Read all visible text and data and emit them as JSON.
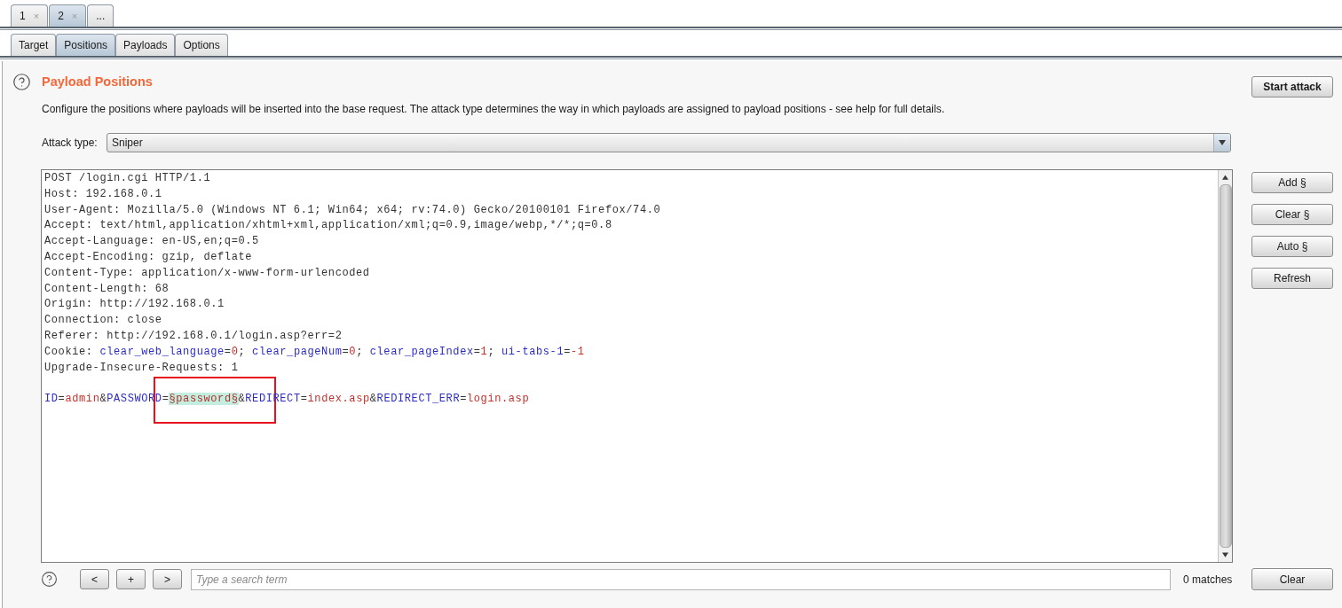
{
  "instance_tabs": [
    {
      "label": "1",
      "close": "×",
      "selected": false
    },
    {
      "label": "2",
      "close": "×",
      "selected": true
    },
    {
      "label": "...",
      "selected": false
    }
  ],
  "tabs": [
    {
      "label": "Target",
      "selected": false
    },
    {
      "label": "Positions",
      "selected": true
    },
    {
      "label": "Payloads",
      "selected": false
    },
    {
      "label": "Options",
      "selected": false
    }
  ],
  "section": {
    "title": "Payload Positions",
    "description": "Configure the positions where payloads will be inserted into the base request. The attack type determines the way in which payloads are assigned to payload positions - see help for full details.",
    "start_button": "Start attack"
  },
  "attack_type": {
    "label": "Attack type:",
    "value": "Sniper"
  },
  "editor": {
    "header_lines": [
      [
        {
          "text": "POST /login.cgi HTTP/1.1",
          "kind": "plain"
        }
      ],
      [
        {
          "text": "Host: 192.168.0.1",
          "kind": "plain"
        }
      ],
      [
        {
          "text": "User-Agent: Mozilla/5.0 (Windows NT 6.1; Win64; x64; rv:74.0) Gecko/20100101 Firefox/74.0",
          "kind": "plain"
        }
      ],
      [
        {
          "text": "Accept: text/html,application/xhtml+xml,application/xml;q=0.9,image/webp,*/*;q=0.8",
          "kind": "plain"
        }
      ],
      [
        {
          "text": "Accept-Language: en-US,en;q=0.5",
          "kind": "plain"
        }
      ],
      [
        {
          "text": "Accept-Encoding: gzip, deflate",
          "kind": "plain"
        }
      ],
      [
        {
          "text": "Content-Type: application/x-www-form-urlencoded",
          "kind": "plain"
        }
      ],
      [
        {
          "text": "Content-Length: 68",
          "kind": "plain"
        }
      ],
      [
        {
          "text": "Origin: http://192.168.0.1",
          "kind": "plain"
        }
      ],
      [
        {
          "text": "Connection: close",
          "kind": "plain"
        }
      ],
      [
        {
          "text": "Referer: http://192.168.0.1/login.asp?err=2",
          "kind": "plain"
        }
      ],
      [
        {
          "text": "Cookie: ",
          "kind": "plain"
        },
        {
          "text": "clear_web_language",
          "kind": "name"
        },
        {
          "text": "=",
          "kind": "plain"
        },
        {
          "text": "0",
          "kind": "value"
        },
        {
          "text": "; ",
          "kind": "plain"
        },
        {
          "text": "clear_pageNum",
          "kind": "name"
        },
        {
          "text": "=",
          "kind": "plain"
        },
        {
          "text": "0",
          "kind": "value"
        },
        {
          "text": "; ",
          "kind": "plain"
        },
        {
          "text": "clear_pageIndex",
          "kind": "name"
        },
        {
          "text": "=",
          "kind": "plain"
        },
        {
          "text": "1",
          "kind": "value"
        },
        {
          "text": "; ",
          "kind": "plain"
        },
        {
          "text": "ui-tabs-1",
          "kind": "name"
        },
        {
          "text": "=",
          "kind": "plain"
        },
        {
          "text": "-1",
          "kind": "value"
        }
      ],
      [
        {
          "text": "Upgrade-Insecure-Requests: 1",
          "kind": "plain"
        }
      ]
    ],
    "body": [
      {
        "text": "ID",
        "kind": "name"
      },
      {
        "text": "=",
        "kind": "plain"
      },
      {
        "text": "admin",
        "kind": "value"
      },
      {
        "text": "&",
        "kind": "plain"
      },
      {
        "text": "PASSWORD",
        "kind": "name"
      },
      {
        "text": "=",
        "kind": "plain"
      },
      {
        "text": "§password§",
        "kind": "marker",
        "boxed": true
      },
      {
        "text": "&",
        "kind": "plain"
      },
      {
        "text": "REDIRECT",
        "kind": "name"
      },
      {
        "text": "=",
        "kind": "plain"
      },
      {
        "text": "index.asp",
        "kind": "value"
      },
      {
        "text": "&",
        "kind": "plain"
      },
      {
        "text": "REDIRECT_ERR",
        "kind": "name"
      },
      {
        "text": "=",
        "kind": "plain"
      },
      {
        "text": "login.asp",
        "kind": "value"
      }
    ]
  },
  "side_buttons": [
    "Add §",
    "Clear §",
    "Auto §",
    "Refresh"
  ],
  "search": {
    "buttons": [
      "<",
      "+",
      ">"
    ],
    "placeholder": "Type a search term",
    "matches": "0 matches",
    "clear_button": "Clear"
  }
}
